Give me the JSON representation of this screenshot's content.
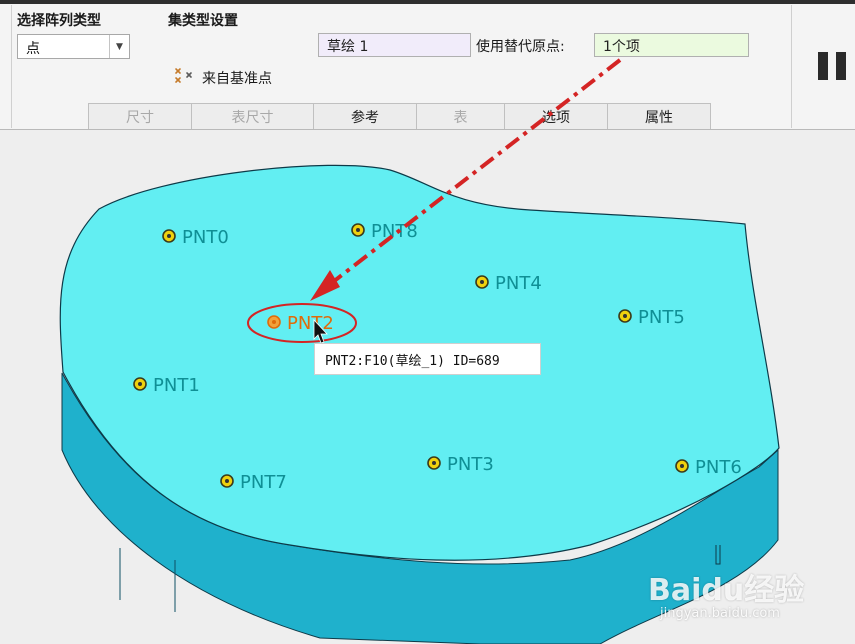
{
  "pattern_type": {
    "label": "选择阵列类型",
    "selected": "点"
  },
  "set_type": {
    "label": "集类型设置"
  },
  "sketch_field": {
    "value": "草绘 1"
  },
  "alt_origin": {
    "label": "使用替代原点:",
    "value": "1个项"
  },
  "from_datum": {
    "label": "来自基准点"
  },
  "tabs": [
    {
      "label": "尺寸",
      "enabled": false
    },
    {
      "label": "表尺寸",
      "enabled": false
    },
    {
      "label": "参考",
      "enabled": true
    },
    {
      "label": "表",
      "enabled": false
    },
    {
      "label": "选项",
      "enabled": true
    },
    {
      "label": "属性",
      "enabled": true
    }
  ],
  "points": [
    {
      "name": "PNT0"
    },
    {
      "name": "PNT8"
    },
    {
      "name": "PNT4"
    },
    {
      "name": "PNT5"
    },
    {
      "name": "PNT2",
      "highlighted": true
    },
    {
      "name": "PNT1"
    },
    {
      "name": "PNT3"
    },
    {
      "name": "PNT6"
    },
    {
      "name": "PNT7"
    }
  ],
  "tooltip": {
    "text": "PNT2:F10(草绘_1) ID=689"
  },
  "watermark": {
    "text": "Baidu经验",
    "url": "jingyan.baidu.com"
  },
  "colors": {
    "part_top": "#62eef2",
    "part_side": "#1fb1cc",
    "point_label": "#0f8f95",
    "highlight": "#e06b0a",
    "annotation": "#d42424",
    "point_fill": "#f0d10e"
  }
}
